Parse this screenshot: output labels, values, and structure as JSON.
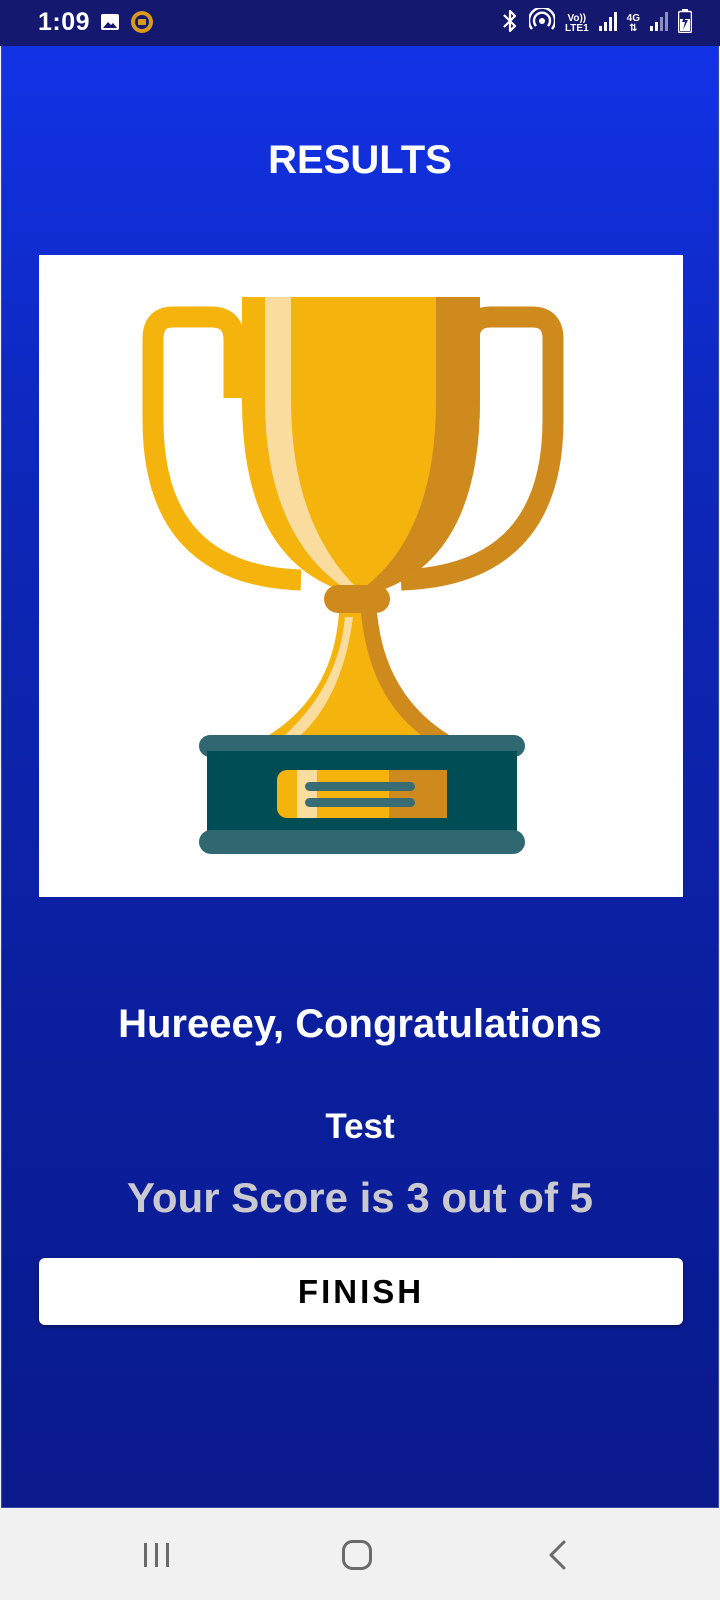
{
  "status_bar": {
    "time": "1:09",
    "network_label_1_top": "Vo))",
    "network_label_1_bottom": "LTE1",
    "network_label_2": "4G"
  },
  "screen": {
    "title": "RESULTS",
    "congrats_message": "Hureeey, Congratulations",
    "quiz_name": "Test",
    "score_text": "Your Score is 3 out of 5",
    "finish_label": "FINISH"
  },
  "score": {
    "correct": 3,
    "total": 5
  },
  "icons": {
    "trophy": "trophy-icon",
    "nav_recents": "recents-icon",
    "nav_home": "home-icon",
    "nav_back": "back-icon"
  },
  "colors": {
    "background_top": "#1232e6",
    "background_bottom": "#0a1a8c",
    "status_bar": "#14186e",
    "trophy_gold": "#f4b40d",
    "trophy_shade": "#cf8a1d",
    "trophy_highlight": "#f9dc9e",
    "trophy_base": "#004d55",
    "score_text": "#c9c9cf"
  }
}
